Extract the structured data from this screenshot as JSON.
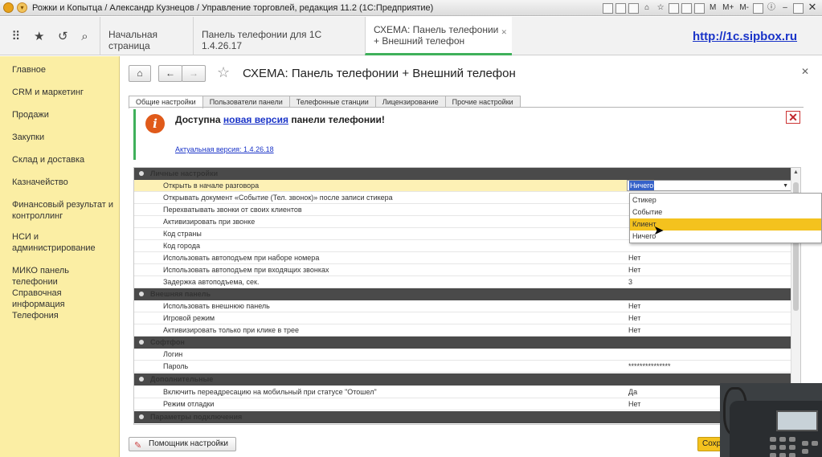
{
  "window": {
    "title": "Рожки и Копытца / Александр Кузнецов / Управление торговлей, редакция 11.2  (1С:Предприятие)",
    "tools": [
      "M",
      "M+",
      "M-"
    ]
  },
  "tabs": [
    {
      "label": "Начальная страница"
    },
    {
      "label": "Панель телефонии для 1С 1.4.26.17"
    },
    {
      "label": "СХЕМА: Панель телефонии + Внешний телефон"
    }
  ],
  "watermark": "http://1c.sipbox.ru",
  "sidebar": {
    "items": [
      "Главное",
      "CRM и маркетинг",
      "Продажи",
      "Закупки",
      "Склад и доставка",
      "Казначейство",
      "Финансовый результат и контроллинг",
      "НСИ и администрирование",
      "МИКО панель телефонии",
      "Справочная информация",
      "Телефония"
    ]
  },
  "page": {
    "title": "СХЕМА: Панель телефонии + Внешний телефон",
    "form_tabs": [
      "Общие настройки",
      "Пользователи панели",
      "Телефонные станции",
      "Лицензирование",
      "Прочие настройки"
    ]
  },
  "banner": {
    "prefix": "Доступна ",
    "link": "новая версия",
    "suffix": " панели телефонии!",
    "version": "Актуальная версия: 1.4.26.18"
  },
  "grid": {
    "rows": [
      {
        "type": "group",
        "label": "Личные настройки"
      },
      {
        "type": "item",
        "label": "Открыть в начале разговора",
        "value": "Ничего",
        "selected": true
      },
      {
        "type": "item",
        "label": "Открывать документ «Событие (Тел. звонок)» после записи стикера",
        "value": ""
      },
      {
        "type": "item",
        "label": "Перехватывать звонки от своих клиентов",
        "value": ""
      },
      {
        "type": "item",
        "label": "Активизировать при звонке",
        "value": ""
      },
      {
        "type": "item",
        "label": "Код страны",
        "value": ""
      },
      {
        "type": "item",
        "label": "Код города",
        "value": ""
      },
      {
        "type": "item",
        "label": "Использовать автоподъем при наборе номера",
        "value": "Нет"
      },
      {
        "type": "item",
        "label": "Использовать автоподъем при входящих звонках",
        "value": "Нет"
      },
      {
        "type": "item",
        "label": "Задержка автоподъема, сек.",
        "value": "3"
      },
      {
        "type": "group",
        "label": "Внешняя панель"
      },
      {
        "type": "item",
        "label": "Использовать внешнюю панель",
        "value": "Нет"
      },
      {
        "type": "item",
        "label": "Игровой режим",
        "value": "Нет"
      },
      {
        "type": "item",
        "label": "Активизировать только при клике в трее",
        "value": "Нет"
      },
      {
        "type": "group",
        "label": "Софтфон"
      },
      {
        "type": "item",
        "label": "Логин",
        "value": ""
      },
      {
        "type": "item",
        "label": "Пароль",
        "value": "***************"
      },
      {
        "type": "group",
        "label": "Дополнительные"
      },
      {
        "type": "item",
        "label": "Включить переадресацию на мобильный при статусе \"Отошел\"",
        "value": "Да"
      },
      {
        "type": "item",
        "label": "Режим отладки",
        "value": "Нет"
      },
      {
        "type": "group",
        "label": "Параметры подключения"
      }
    ]
  },
  "dropdown": {
    "options": [
      "Стикер",
      "Событие",
      "Клиент",
      "Ничего"
    ],
    "highlighted": "Клиент"
  },
  "bottom": {
    "helper_label": "Помощник настройки",
    "save_label": "Сохранить"
  },
  "colors": {
    "sidebar_bg": "#fbeea4",
    "accent_green": "#3fb05a",
    "highlight_yellow": "#f4c21e",
    "group_header": "#4a4a4a"
  }
}
